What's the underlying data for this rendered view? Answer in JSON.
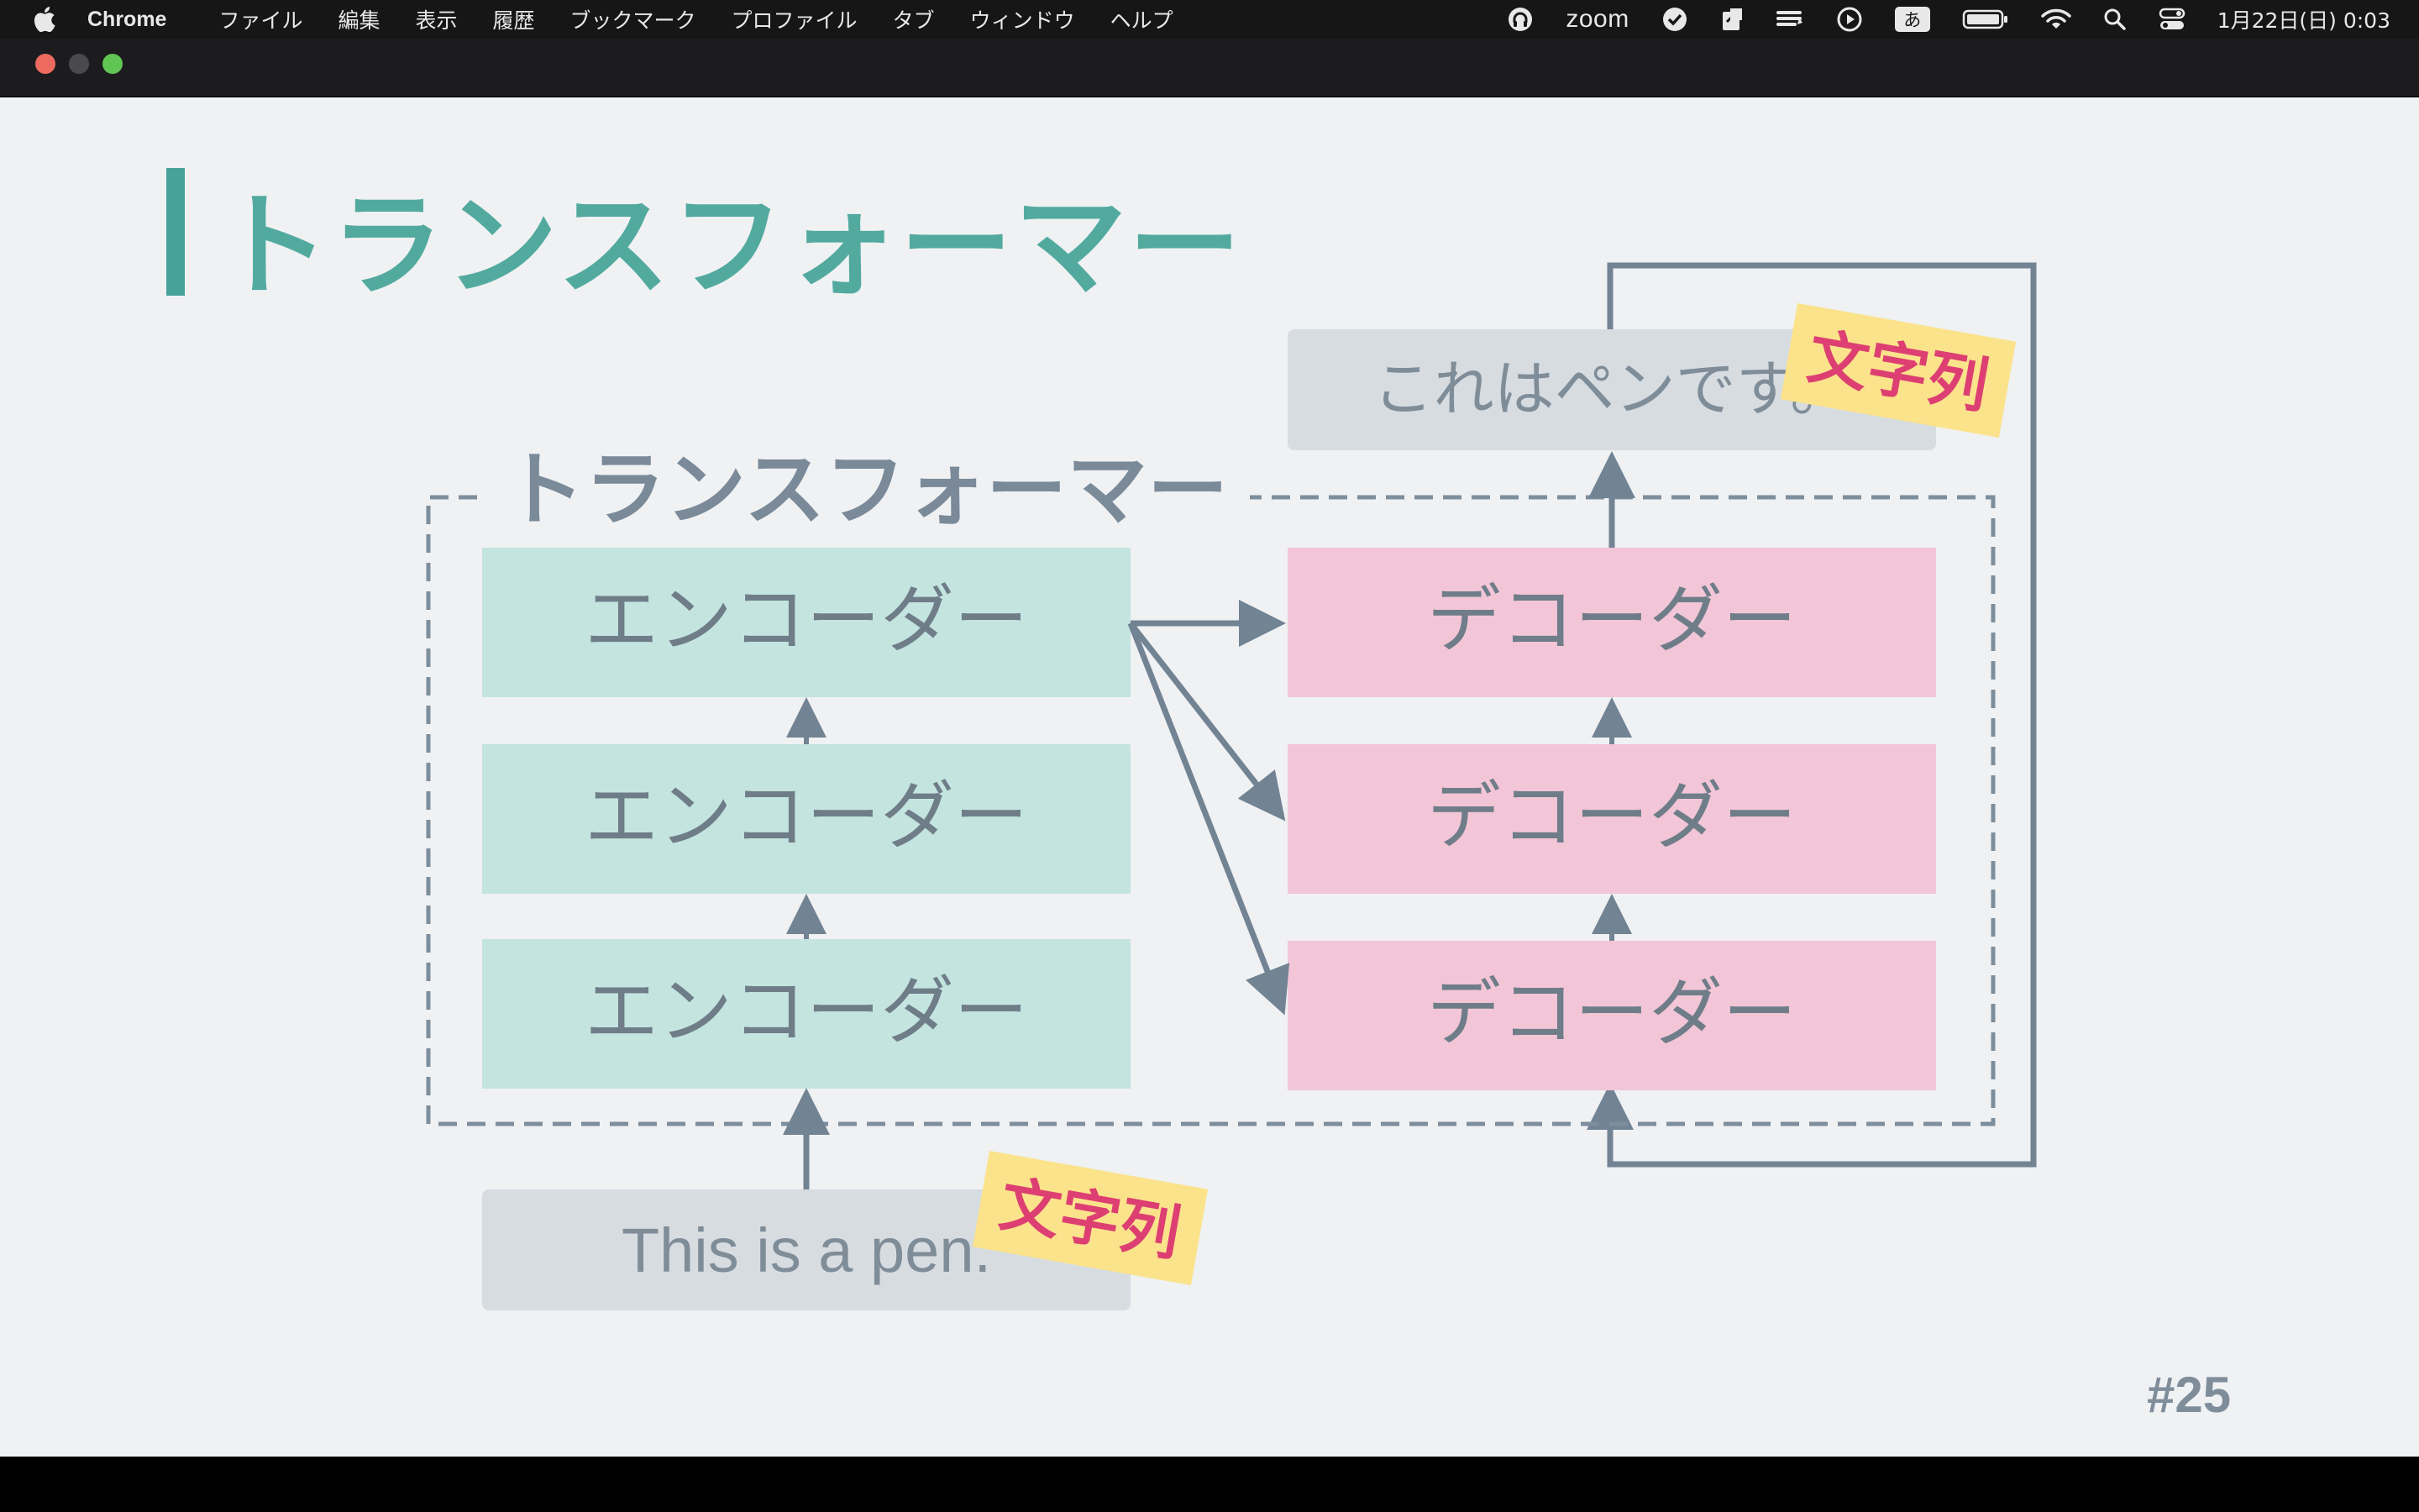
{
  "menubar": {
    "apple_icon": "apple-icon",
    "app_name": "Chrome",
    "items": [
      "ファイル",
      "編集",
      "表示",
      "履歴",
      "ブックマーク",
      "プロファイル",
      "タブ",
      "ウィンドウ",
      "ヘルプ"
    ],
    "status": {
      "zoom_label": "zoom",
      "ime_label": "あ",
      "datetime": "1月22日(日)  0:03"
    }
  },
  "slide": {
    "title": "トランスフォーマー",
    "diagram": {
      "group_label": "トランスフォーマー",
      "encoders": [
        "エンコーダー",
        "エンコーダー",
        "エンコーダー"
      ],
      "decoders": [
        "デコーダー",
        "デコーダー",
        "デコーダー"
      ],
      "input_text": "This is a pen.",
      "output_text": "これはペンです。",
      "input_tag": "文字列",
      "output_tag": "文字列"
    },
    "page_number": "#25"
  },
  "colors": {
    "title": "#52aa9f",
    "encoder_fill": "#c4e4e0",
    "decoder_fill": "#f2c6d7",
    "io_fill": "#d6dbe0",
    "arrow": "#728393",
    "tag_fill": "#fbe38b",
    "tag_text": "#dd3f73"
  }
}
